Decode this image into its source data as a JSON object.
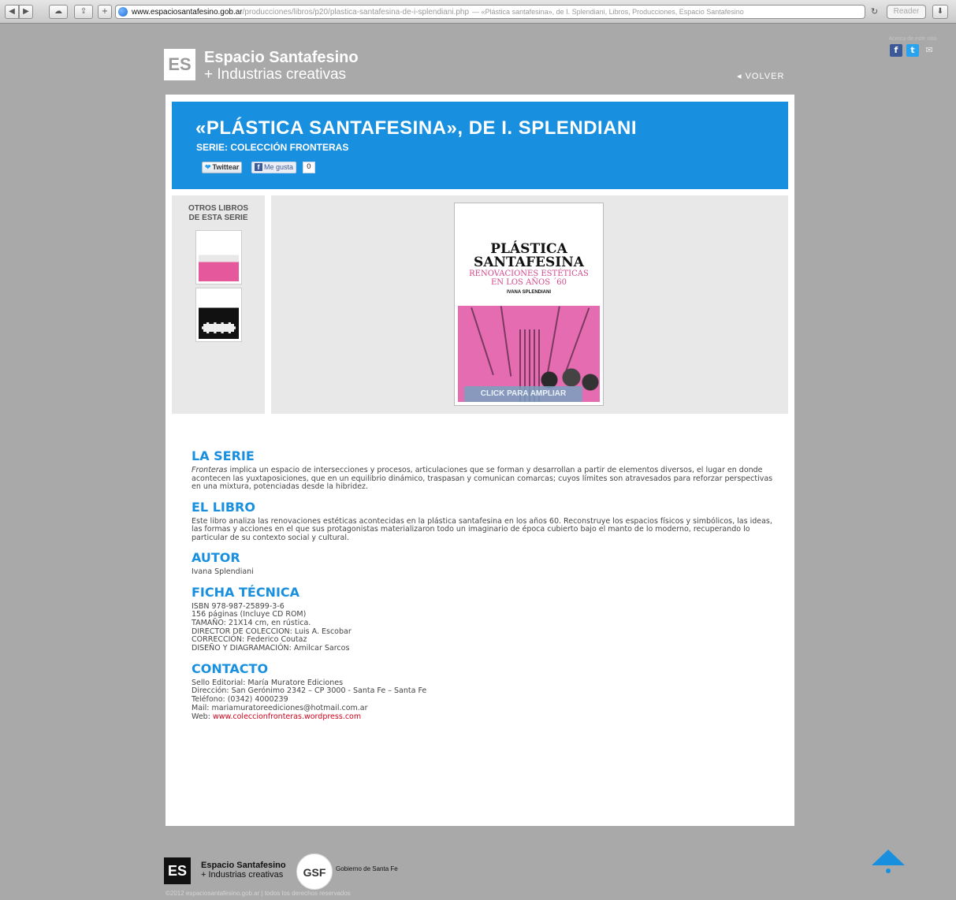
{
  "browser": {
    "url_host": "www.espaciosantafesino.gob.ar",
    "url_path": "/producciones/libros/p20/plastica-santafesina-de-i-splendiani.php",
    "page_title": "— «Plástica santafesina», de I. Splendiani, Libros, Producciones, Espacio Santafesino",
    "reader_label": "Reader"
  },
  "header": {
    "logo_text": "ES",
    "brand_line1": "Espacio Santafesino",
    "brand_line2": "+ Industrias creativas",
    "back_label": "VOLVER",
    "share_label": "Acerca de este sitio"
  },
  "hero": {
    "title": "«PLÁSTICA SANTAFESINA», DE I. SPLENDIANI",
    "subtitle": "SERIE: COLECCIÓN FRONTERAS",
    "tweet_label": "Twittear",
    "like_label": "Me gusta",
    "like_count": "0"
  },
  "sidebar": {
    "title_line1": "OTROS LIBROS",
    "title_line2": "DE ESTA SERIE"
  },
  "cover": {
    "title_line1": "PLÁSTICA",
    "title_line2": "SANTAFESINA",
    "subtitle_line1": "RENOVACIONES ESTÉTICAS",
    "subtitle_line2": "EN LOS AÑOS ´60",
    "author": "IVANA SPLENDIANI",
    "zoom_label": "CLICK PARA AMPLIAR"
  },
  "sections": {
    "serie": {
      "heading": "LA SERIE",
      "italic_word": "Fronteras",
      "body": " implica un espacio de intersecciones y procesos, articulaciones que se forman y desarrollan a partir de elementos diversos, el lugar en donde acontecen las yuxtaposiciones, que en un equilibrio dinámico, traspasan y comunican comarcas; cuyos límites son atravesados para reforzar perspectivas en una mixtura, potenciadas desde la hibridez."
    },
    "libro": {
      "heading": "EL LIBRO",
      "body": "Este libro analiza las renovaciones estéticas acontecidas en la plástica santafesina en los años 60. Reconstruye los espacios físicos y simbólicos, las ideas, las formas y acciones en el que sus protagonistas materializaron todo un imaginario de época cubierto bajo el manto de lo moderno, recuperando lo particular de su contexto social y cultural."
    },
    "autor": {
      "heading": "AUTOR",
      "body": "Ivana Splendiani"
    },
    "ficha": {
      "heading": "FICHA TÉCNICA",
      "lines": [
        "ISBN 978-987-25899-3-6",
        "156 páginas (Incluye CD ROM)",
        "TAMAÑO: 21X14 cm, en rústica.",
        "DIRECTOR DE COLECCION: Luis A. Escobar",
        "CORRECCIÓN: Federico Coutaz",
        "DISEÑO Y DIAGRAMACIÓN: Amilcar Sarcos"
      ]
    },
    "contacto": {
      "heading": "CONTACTO",
      "lines": [
        "Sello Editorial: María Muratore Ediciones",
        "Dirección: San Gerónimo 2342 – CP 3000 - Santa Fe – Santa Fe",
        "Teléfono: (0342) 4000239",
        "Mail: mariamuratoreediciones@hotmail.com.ar"
      ],
      "web_label": "Web: ",
      "web_link": "www.coleccionfronteras.wordpress.com"
    }
  },
  "footer": {
    "logo_text": "ES",
    "brand_line1": "Espacio Santafesino",
    "brand_line2": "+ Industrias creativas",
    "gsf_text": "GSF",
    "gov_label": "Gobierno de Santa Fe",
    "copyright": "©2012 espaciosantafesino.gob.ar | todos los derechos reservados"
  },
  "colors": {
    "accent_blue": "#1890df",
    "page_gray": "#a9a9a9",
    "link_red": "#d0021b"
  }
}
